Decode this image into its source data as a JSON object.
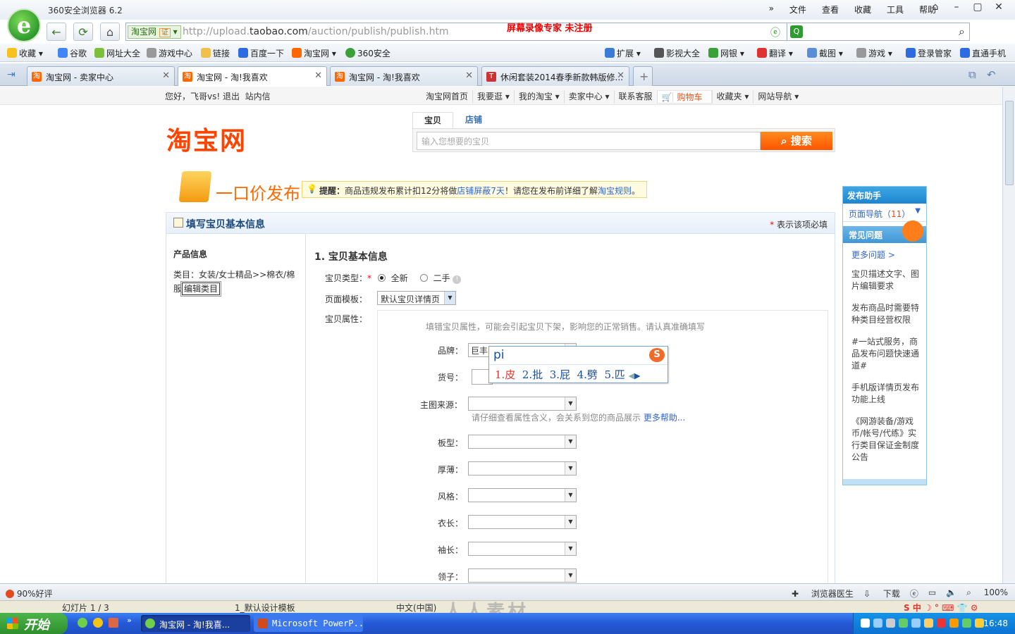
{
  "browser": {
    "title": "360安全浏览器 6.2",
    "menus": [
      "文件",
      "查看",
      "收藏",
      "工具",
      "帮助"
    ],
    "site_badge": "淘宝网",
    "cert_label": "证",
    "url_prefix": "http://upload.",
    "url_domain": "taobao.com",
    "url_path": "/auction/publish/publish.htm",
    "recorder_watermark": "屏幕录像专家  未注册"
  },
  "favorites": {
    "left": [
      "收藏",
      "谷歌",
      "网址大全",
      "游戏中心",
      "链接",
      "百度一下",
      "淘宝网",
      "360安全"
    ],
    "right": [
      "扩展",
      "影视大全",
      "网银",
      "翻译",
      "截图",
      "游戏",
      "登录管家",
      "直通手机"
    ]
  },
  "tabs": [
    {
      "label": "淘宝网 - 卖家中心",
      "active": false
    },
    {
      "label": "淘宝网 - 淘!我喜欢",
      "active": true
    },
    {
      "label": "淘宝网 - 淘!我喜欢",
      "active": false
    },
    {
      "label": "休闲套装2014春季新款韩版修...",
      "active": false
    }
  ],
  "site_nav": {
    "greeting": "您好，飞哥vs!",
    "logout": "退出",
    "inbox": "站内信",
    "links": [
      "淘宝网首页",
      "我要逛 ▾",
      "我的淘宝 ▾",
      "卖家中心 ▾",
      "联系客服",
      "购物车",
      "收藏夹 ▾",
      "网站导航 ▾"
    ]
  },
  "header": {
    "logo": "淘宝网",
    "search_tabs": [
      "宝贝",
      "店铺"
    ],
    "search_placeholder": "输入您想要的宝贝",
    "search_button": "搜索"
  },
  "publish": {
    "title": "一口价发布",
    "notice_label": "提醒：",
    "notice_text1": "商品违规发布累计扣12分将做",
    "notice_link1": "店铺屏蔽7天",
    "notice_text2": "！请您在发布前详细了解",
    "notice_link2": "淘宝规则",
    "notice_end": "。"
  },
  "form": {
    "heading": "填写宝贝基本信息",
    "required_note": "表示该项必填",
    "product_info": "产品信息",
    "category": "类目：女装/女士精品>>棉衣/棉服",
    "edit_category": "编辑类目",
    "section_title": "1. 宝贝基本信息",
    "type_label": "宝贝类型：",
    "type_new": "全新",
    "type_used": "二手",
    "template_label": "页面模板：",
    "template_value": "默认宝贝详情页",
    "attr_label": "宝贝属性：",
    "attr_hint": "填错宝贝属性，可能会引起宝贝下架，影响您的正常销售。请认真准确填写",
    "brand_label": "品牌：",
    "brand_value": "巨丰",
    "sku_label": "货号：",
    "image_source_label": "主图来源：",
    "image_source_hint": "请仔细查看属性含义，会关系到您的商品展示",
    "image_source_more": "更多帮助...",
    "fields": [
      "板型：",
      "厚薄：",
      "风格：",
      "衣长：",
      "袖长：",
      "领子："
    ]
  },
  "ime": {
    "pinyin": "pi",
    "candidates": [
      "1.皮",
      "2.批",
      "3.屁",
      "4.劈",
      "5.匹"
    ]
  },
  "helper": {
    "title": "发布助手",
    "nav_label": "页面导航（",
    "nav_count": "11",
    "nav_end": "）",
    "faq_title": "常见问题",
    "more": "更多问题 >",
    "items": [
      "宝贝描述文字、图片编辑要求",
      "发布商品时需要特种类目经营权限",
      "#一站式服务，商品发布问题快速通道#",
      "手机版详情页发布功能上线",
      "《网游装备/游戏币/帐号/代练》实行类目保证金制度公告"
    ]
  },
  "statusbar": {
    "rating": "90%好评",
    "right": [
      "浏览器医生",
      "下载",
      "100%"
    ]
  },
  "ppt": {
    "slide": "幻灯片 1 / 3",
    "template": "1_默认设计模板",
    "lang": "中文(中国)",
    "watermark": "人人素材"
  },
  "taskbar": {
    "start": "开始",
    "tasks": [
      "淘宝网 - 淘!我喜...",
      "Microsoft PowerP..."
    ],
    "clock": "16:48"
  },
  "colors": {
    "taobao_orange": "#ff4400",
    "link_blue": "#3366cc",
    "accent_green": "#2e9b2e"
  }
}
